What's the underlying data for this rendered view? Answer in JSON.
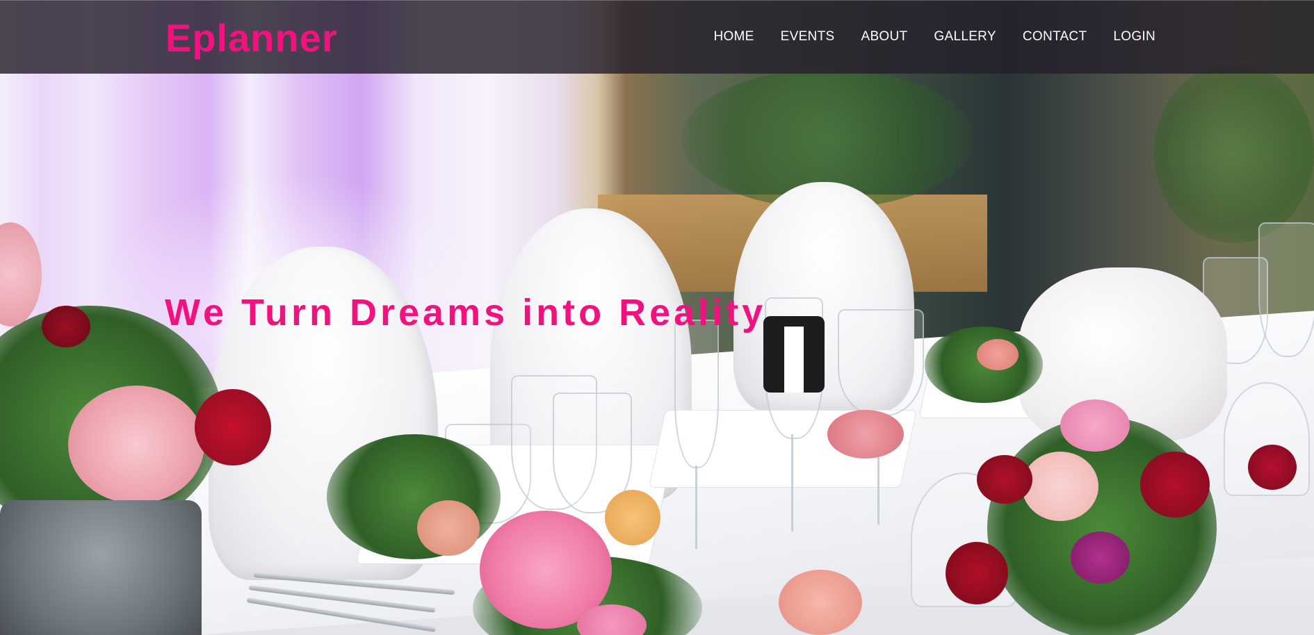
{
  "brand": {
    "name": "Eplanner",
    "accent_color": "#f2127f"
  },
  "nav": {
    "items": [
      {
        "label": "HOME"
      },
      {
        "label": "EVENTS"
      },
      {
        "label": "ABOUT"
      },
      {
        "label": "GALLERY"
      },
      {
        "label": "CONTACT"
      },
      {
        "label": "LOGIN"
      }
    ]
  },
  "hero": {
    "headline": "We Turn Dreams into Reality",
    "background_image": "wedding-table-banquet-photo"
  }
}
